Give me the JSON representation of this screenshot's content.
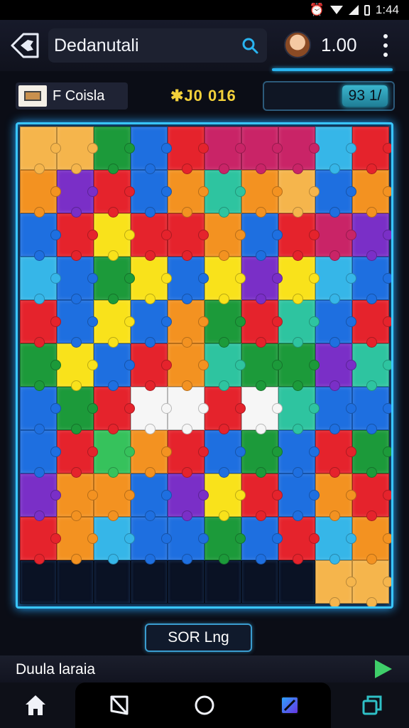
{
  "status_bar": {
    "time": "1:44",
    "alarm_glyph": "⏰"
  },
  "header": {
    "search_text": "Dedanutali",
    "score": "1.00",
    "icons": [
      "puzzle-back-icon",
      "search-icon",
      "avatar",
      "more-vert-icon"
    ]
  },
  "info_bar": {
    "level_label": "F Coisla",
    "timer_star": "✱",
    "timer": "J0 016",
    "moves": "93 1/"
  },
  "board": {
    "rows": 11,
    "cols": 10,
    "palette": {
      "red": "#e5232c",
      "orange": "#f39221",
      "yellow": "#f9e21b",
      "green": "#1c9a3a",
      "lime": "#36c25c",
      "teal": "#2ec4a0",
      "cyan": "#36b6e8",
      "blue": "#1e6fe0",
      "purple": "#7a2fc7",
      "magenta": "#c92467",
      "white": "#f6f6f6",
      "ltorange": "#f5b54c",
      "empty": "#0a1224"
    },
    "tiles": [
      [
        "ltorange",
        "ltorange",
        "green",
        "blue",
        "red",
        "magenta",
        "magenta",
        "magenta",
        "cyan",
        "red"
      ],
      [
        "orange",
        "purple",
        "red",
        "blue",
        "orange",
        "teal",
        "orange",
        "ltorange",
        "blue",
        "orange"
      ],
      [
        "blue",
        "red",
        "yellow",
        "red",
        "red",
        "orange",
        "blue",
        "red",
        "magenta",
        "purple"
      ],
      [
        "cyan",
        "blue",
        "green",
        "yellow",
        "blue",
        "yellow",
        "purple",
        "yellow",
        "cyan",
        "blue"
      ],
      [
        "red",
        "blue",
        "yellow",
        "blue",
        "orange",
        "green",
        "red",
        "teal",
        "blue",
        "red"
      ],
      [
        "green",
        "yellow",
        "blue",
        "red",
        "orange",
        "teal",
        "green",
        "green",
        "purple",
        "teal"
      ],
      [
        "blue",
        "green",
        "red",
        "white",
        "white",
        "red",
        "white",
        "teal",
        "blue",
        "blue"
      ],
      [
        "blue",
        "red",
        "lime",
        "orange",
        "red",
        "blue",
        "green",
        "blue",
        "red",
        "green"
      ],
      [
        "purple",
        "orange",
        "orange",
        "blue",
        "purple",
        "yellow",
        "red",
        "blue",
        "orange",
        "red"
      ],
      [
        "red",
        "orange",
        "cyan",
        "blue",
        "blue",
        "green",
        "blue",
        "red",
        "cyan",
        "orange"
      ],
      [
        "empty",
        "empty",
        "empty",
        "empty",
        "empty",
        "empty",
        "empty",
        "empty",
        "ltorange",
        "ltorange"
      ]
    ]
  },
  "sort_button": {
    "label": "SOR Lng"
  },
  "caption": {
    "text": "Duula laraia"
  },
  "nav": {
    "items": [
      "home-icon",
      "back-icon",
      "circle-home-icon",
      "app-icon",
      "recent-apps-icon"
    ]
  }
}
